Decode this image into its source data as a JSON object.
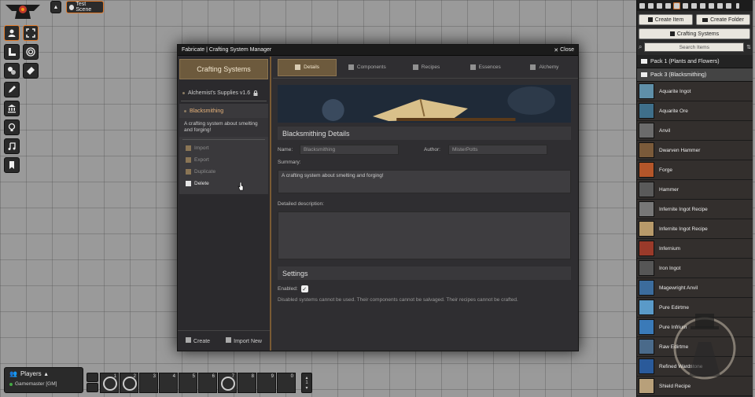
{
  "top": {
    "scene_name": "Test Scene"
  },
  "window": {
    "title": "Fabricate | Crafting System Manager",
    "close_label": "Close",
    "left": {
      "header": "Crafting Systems",
      "systems": [
        {
          "label": "Alchemist's Supplies v1.6"
        },
        {
          "label": "Blacksmithing"
        }
      ],
      "selected_description": "A crafting system about smelting and forging!",
      "actions": [
        {
          "label": "Import"
        },
        {
          "label": "Export"
        },
        {
          "label": "Duplicate"
        },
        {
          "label": "Delete"
        }
      ],
      "footer_create": "Create",
      "footer_import": "Import New"
    },
    "tabs": [
      {
        "label": "Details"
      },
      {
        "label": "Components"
      },
      {
        "label": "Recipes"
      },
      {
        "label": "Essences"
      },
      {
        "label": "Alchemy"
      }
    ],
    "details": {
      "section_title": "Blacksmithing Details",
      "name_label": "Name:",
      "name_value": "Blacksmithing",
      "author_label": "Author:",
      "author_value": "MisterPotts",
      "summary_label": "Summary:",
      "summary_value": "A crafting system about smelting and forging!",
      "description_label": "Detailed description:",
      "description_value": ""
    },
    "settings": {
      "section_title": "Settings",
      "enabled_label": "Enabled:",
      "enabled_check": "✓",
      "note": "Disabled systems cannot be used. Their components cannot be salvaged. Their recipes cannot be crafted."
    }
  },
  "sidebar": {
    "create_item": "Create Item",
    "create_folder": "Create Folder",
    "crafting_systems": "Crafting Systems",
    "search_placeholder": "Search Items",
    "pack1": "Pack 1 (Plants and Flowers)",
    "pack3": "Pack 3 (Blacksmithing)",
    "items": [
      {
        "label": "Aquarite Ingot",
        "color": "#5f8fa8"
      },
      {
        "label": "Aquarite Ore",
        "color": "#3f6f8a"
      },
      {
        "label": "Anvil",
        "color": "#6b6b6b"
      },
      {
        "label": "Dwarven Hammer",
        "color": "#7a5a3a"
      },
      {
        "label": "Forge",
        "color": "#b4562a"
      },
      {
        "label": "Hammer",
        "color": "#5a5a5a"
      },
      {
        "label": "Infernite Ingot Recipe",
        "color": "#777777"
      },
      {
        "label": "Infernite Ingot Recipe",
        "color": "#b89a6a"
      },
      {
        "label": "Infernium",
        "color": "#9a3a2a"
      },
      {
        "label": "Iron Ingot",
        "color": "#565656"
      },
      {
        "label": "Magewright Anvil",
        "color": "#3c6c9c"
      },
      {
        "label": "Pure Edirtme",
        "color": "#5a9ac8"
      },
      {
        "label": "Pure Infrium",
        "color": "#3a7ab8"
      },
      {
        "label": "Raw Edirtme",
        "color": "#4a6a8a"
      },
      {
        "label": "Refined Wardstone",
        "color": "#2a5a9a"
      },
      {
        "label": "Shield Recipe",
        "color": "#b8a07a"
      }
    ]
  },
  "players": {
    "title": "Players",
    "gm": "Gamemaster [GM]"
  },
  "hotbar": {
    "slots": [
      "1",
      "2",
      "3",
      "4",
      "5",
      "6",
      "7",
      "8",
      "9",
      "0"
    ],
    "page": "1"
  },
  "colors": {
    "accent": "#e37b2a",
    "tab_active": "#6d5a3d",
    "selected_text": "#e8b37a"
  }
}
